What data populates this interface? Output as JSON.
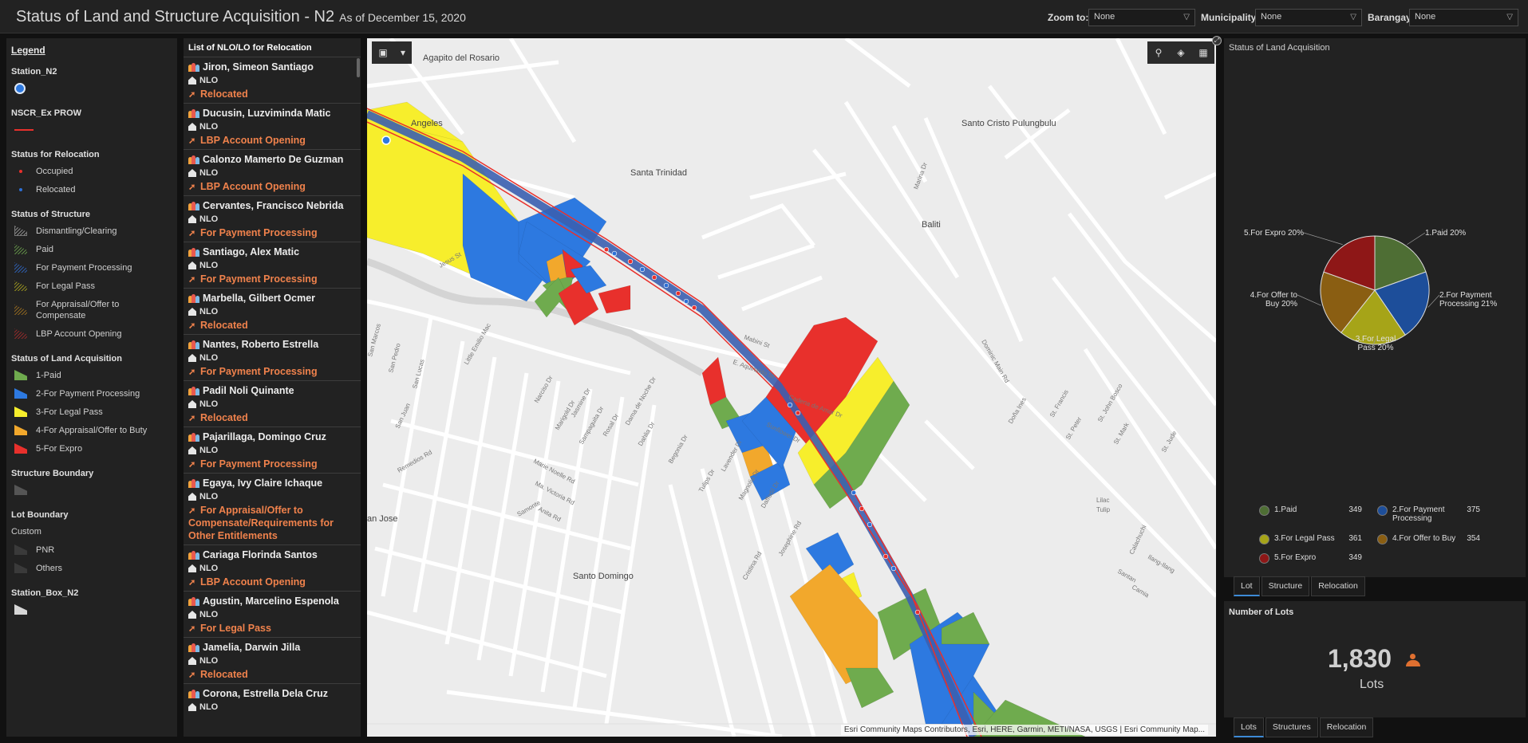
{
  "header": {
    "title": "Status of Land and Structure Acquisition - N2",
    "subtitle": "As of December 15, 2020",
    "zoom_label": "Zoom to:",
    "zoom_value": "None",
    "municipality_label": "Municipality",
    "municipality_value": "None",
    "barangay_label": "Barangay",
    "barangay_value": "None"
  },
  "legend": {
    "title": "Legend",
    "station_group": "Station_N2",
    "prow_group": "NSCR_Ex PROW",
    "relocation_group": "Status for Relocation",
    "relocation_items": [
      {
        "label": "Occupied",
        "color": "#e8302c"
      },
      {
        "label": "Relocated",
        "color": "#2d6fd6"
      }
    ],
    "structure_group": "Status of Structure",
    "structure_items": [
      {
        "label": "Dismantling/Clearing"
      },
      {
        "label": "Paid"
      },
      {
        "label": "For Payment Processing"
      },
      {
        "label": "For Legal Pass"
      },
      {
        "label": "For Appraisal/Offer to Compensate"
      },
      {
        "label": "LBP Account Opening"
      }
    ],
    "land_group": "Status of Land Acquisition",
    "land_items": [
      {
        "label": "1-Paid",
        "color": "#6fab4e"
      },
      {
        "label": "2-For Payment Processing",
        "color": "#2d79e0"
      },
      {
        "label": "3-For Legal Pass",
        "color": "#f7ee2c"
      },
      {
        "label": "4-For Appraisal/Offer to Buty",
        "color": "#f2a82c"
      },
      {
        "label": "5-For Expro",
        "color": "#e8302c"
      }
    ],
    "structure_boundary_group": "Structure Boundary",
    "lot_boundary_group": "Lot Boundary",
    "lot_boundary_sub": "Custom",
    "lot_boundary_items": [
      {
        "label": "PNR"
      },
      {
        "label": "Others"
      }
    ],
    "station_box_group": "Station_Box_N2"
  },
  "list": {
    "title": "List of NLO/LO for Relocation",
    "items": [
      {
        "name": "Jiron, Simeon Santiago",
        "type": "NLO",
        "status": "Relocated"
      },
      {
        "name": "Ducusin, Luzviminda Matic",
        "type": "NLO",
        "status": "LBP Account Opening"
      },
      {
        "name": "Calonzo Mamerto De Guzman",
        "type": "NLO",
        "status": "LBP Account Opening"
      },
      {
        "name": "Cervantes, Francisco Nebrida",
        "type": "NLO",
        "status": "For Payment Processing"
      },
      {
        "name": "Santiago, Alex Matic",
        "type": "NLO",
        "status": "For Payment Processing"
      },
      {
        "name": "Marbella, Gilbert Ocmer",
        "type": "NLO",
        "status": "Relocated"
      },
      {
        "name": "Nantes, Roberto Estrella",
        "type": "NLO",
        "status": "For Payment Processing"
      },
      {
        "name": "Padil Noli Quinante",
        "type": "NLO",
        "status": "Relocated"
      },
      {
        "name": "Pajarillaga, Domingo Cruz",
        "type": "NLO",
        "status": "For Payment Processing"
      },
      {
        "name": "Egaya, Ivy Claire Ichaque",
        "type": "NLO",
        "status": "For Appraisal/Offer to Compensate/Requirements for Other Entitlements"
      },
      {
        "name": "Cariaga Florinda Santos",
        "type": "NLO",
        "status": "LBP Account Opening"
      },
      {
        "name": "Agustin, Marcelino Espenola",
        "type": "NLO",
        "status": "For Legal Pass"
      },
      {
        "name": "Jamelia, Darwin Jilla",
        "type": "NLO",
        "status": "Relocated"
      },
      {
        "name": "Corona, Estrella Dela Cruz",
        "type": "NLO",
        "status": ""
      }
    ]
  },
  "map": {
    "place_labels": [
      "Agapito del Rosario",
      "Angeles",
      "Santo Cristo Pulungbulu",
      "Santa Trinidad",
      "Baliti",
      "Santo Domingo",
      "an Jose"
    ],
    "street_labels": [
      "Marina Dr",
      "Dominic Main Rd",
      "Mabini St",
      "Jesus St",
      "E. Aquinaldo St",
      "Cadena de Amor Dr",
      "Sunflower Dr",
      "San Marcos",
      "San Pedro",
      "San Lucas",
      "San Juan",
      "Little Emilio Mac",
      "Narciso Dr",
      "Marigold Dr",
      "Jasmine Dr",
      "Sampaguita Dr",
      "Rosal Dr",
      "Dama de Noche Dr",
      "Dahlia Dr",
      "Begonia Dr",
      "Tulips Dr",
      "Lavender Dr",
      "Magnolia Dr",
      "Daffodil Dr",
      "Marie Noelle Rd",
      "Ma. Victoria Rd",
      "Anita Rd",
      "Camia",
      "Santan",
      "Ilang-Ilang",
      "Calachuchi",
      "Lilac",
      "Tulip",
      "Doña Ines",
      "St. Francis",
      "St. Peter",
      "St. John Bosco",
      "St. Mark",
      "St. Jude",
      "Remedios Rd",
      "Samonte",
      "Josephine Rd",
      "Cristina Rd"
    ],
    "attribution": "Esri Community Maps Contributors, Esri, HERE, Garmin, METI/NASA, USGS | Esri Community Map...",
    "colors": {
      "paid": "#6fab4e",
      "payment": "#2d79e0",
      "legal": "#f7ee2c",
      "offer": "#f2a82c",
      "expro": "#e8302c"
    }
  },
  "pie_panel": {
    "title": "Status of Land Acquisition",
    "chart_data": {
      "type": "pie",
      "slices": [
        {
          "label": "1.Paid",
          "value": 349,
          "percent_label": "1.Paid 20%",
          "color": "#4e6e34"
        },
        {
          "label": "2.For Payment Processing",
          "value": 375,
          "percent_label": "2.For Payment Processing 21%",
          "color": "#1d4e9a"
        },
        {
          "label": "3.For Legal Pass",
          "value": 361,
          "percent_label": "3.For Legal Pass 20%",
          "color": "#a6a418"
        },
        {
          "label": "4.For Offer to Buy",
          "value": 354,
          "percent_label": "4.For Offer to Buy 20%",
          "color": "#8a5e12"
        },
        {
          "label": "5.For Expro",
          "value": 349,
          "percent_label": "5.For Expro 20%",
          "color": "#8e1717"
        }
      ]
    },
    "tabs": [
      "Lot",
      "Structure",
      "Relocation"
    ]
  },
  "count_panel": {
    "title": "Number of Lots",
    "value": "1,830",
    "unit": "Lots",
    "tabs": [
      "Lots",
      "Structures",
      "Relocation"
    ]
  }
}
